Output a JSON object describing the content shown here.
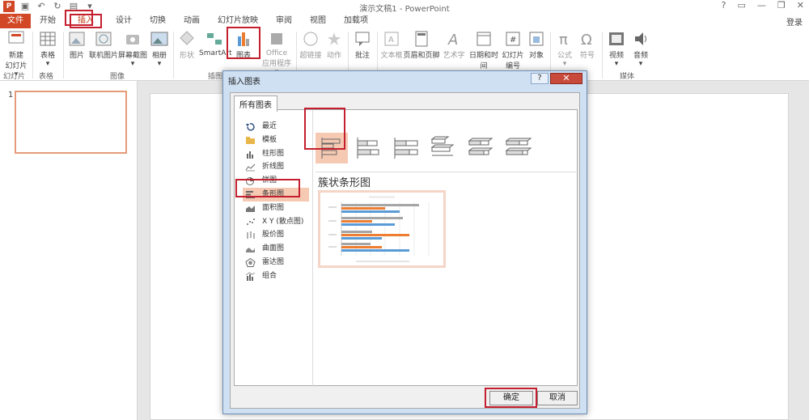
{
  "titlebar": {
    "logo": "P",
    "title": "演示文稿1 - PowerPoint",
    "help": "?",
    "restore_ribbon": "▭",
    "minimize": "—",
    "maximize": "❐",
    "close": "✕"
  },
  "tabs": [
    "文件",
    "开始",
    "插入",
    "设计",
    "切换",
    "动画",
    "幻灯片放映",
    "审阅",
    "视图",
    "加载项"
  ],
  "active_tab": "插入",
  "login": "登录",
  "ribbon": {
    "buttons": [
      {
        "label1": "新建",
        "label2": "幻灯片 ▾",
        "icon": "new-slide-icon"
      },
      {
        "label1": "表格",
        "label2": "▾",
        "icon": "table-icon"
      },
      {
        "label1": "图片",
        "label2": "",
        "icon": "picture-icon"
      },
      {
        "label1": "联机图片",
        "label2": "",
        "icon": "online-picture-icon"
      },
      {
        "label1": "屏幕截图",
        "label2": "▾",
        "icon": "screenshot-icon"
      },
      {
        "label1": "相册",
        "label2": "▾",
        "icon": "album-icon"
      },
      {
        "label1": "形状",
        "label2": "",
        "icon": "shapes-icon"
      },
      {
        "label1": "SmartArt",
        "label2": "",
        "icon": "smartart-icon"
      },
      {
        "label1": "图表",
        "label2": "",
        "icon": "chart-icon"
      },
      {
        "label1": "Office",
        "label2": "应用程序 ▾",
        "icon": "office-apps-icon"
      },
      {
        "label1": "超链接",
        "label2": "",
        "icon": "hyperlink-icon"
      },
      {
        "label1": "动作",
        "label2": "",
        "icon": "action-icon"
      },
      {
        "label1": "批注",
        "label2": "",
        "icon": "comment-icon"
      },
      {
        "label1": "文本框",
        "label2": "",
        "icon": "textbox-icon"
      },
      {
        "label1": "页眉和页脚",
        "label2": "",
        "icon": "header-footer-icon"
      },
      {
        "label1": "艺术字",
        "label2": "",
        "icon": "wordart-icon"
      },
      {
        "label1": "日期和时间",
        "label2": "",
        "icon": "datetime-icon"
      },
      {
        "label1": "幻灯片",
        "label2": "编号",
        "icon": "slide-number-icon"
      },
      {
        "label1": "对象",
        "label2": "",
        "icon": "object-icon"
      },
      {
        "label1": "公式",
        "label2": "▾",
        "icon": "equation-icon"
      },
      {
        "label1": "符号",
        "label2": "",
        "icon": "symbol-icon"
      },
      {
        "label1": "视频",
        "label2": "▾",
        "icon": "video-icon"
      },
      {
        "label1": "音频",
        "label2": "▾",
        "icon": "audio-icon"
      }
    ],
    "groups": [
      "幻灯片",
      "表格",
      "图像",
      "插图",
      "媒体"
    ]
  },
  "slide_pane": {
    "number": "1"
  },
  "dialog": {
    "title": "插入图表",
    "help": "?",
    "close": "✕",
    "tab": "所有图表",
    "categories": [
      {
        "label": "最近",
        "icon": "recent-icon"
      },
      {
        "label": "模板",
        "icon": "template-folder-icon"
      },
      {
        "label": "柱形图",
        "icon": "column-chart-icon"
      },
      {
        "label": "折线图",
        "icon": "line-chart-icon"
      },
      {
        "label": "饼图",
        "icon": "pie-chart-icon"
      },
      {
        "label": "条形图",
        "icon": "bar-chart-icon"
      },
      {
        "label": "面积图",
        "icon": "area-chart-icon"
      },
      {
        "label": "X Y (散点图)",
        "icon": "scatter-chart-icon"
      },
      {
        "label": "股价图",
        "icon": "stock-chart-icon"
      },
      {
        "label": "曲面图",
        "icon": "surface-chart-icon"
      },
      {
        "label": "雷达图",
        "icon": "radar-chart-icon"
      },
      {
        "label": "组合",
        "icon": "combo-chart-icon"
      }
    ],
    "selected_category": "条形图",
    "chart_types": [
      "clustered-bar",
      "stacked-bar",
      "100-stacked-bar",
      "3d-clustered-bar",
      "3d-stacked-bar",
      "3d-100-stacked-bar"
    ],
    "selected_type_name": "簇状条形图",
    "ok": "确定",
    "cancel": "取消"
  },
  "colors": {
    "accent": "#d24726",
    "highlight": "#c41f2e",
    "selection": "#f6c9b3",
    "series1": "#5b9bd5",
    "series2": "#ed7d31",
    "series3": "#a5a5a5"
  }
}
